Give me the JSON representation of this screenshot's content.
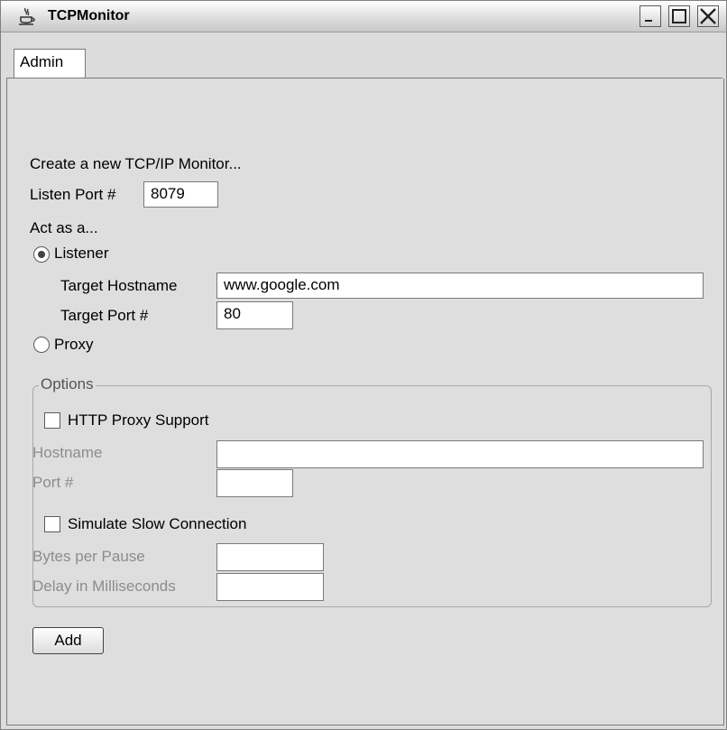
{
  "window": {
    "title": "TCPMonitor",
    "icon": "java-cup-icon",
    "controls": [
      "minimize-icon",
      "maximize-icon",
      "close-icon"
    ]
  },
  "tabs": [
    {
      "label": "Admin",
      "selected": true
    }
  ],
  "admin": {
    "heading": "Create a new TCP/IP Monitor...",
    "listen_port_label": "Listen Port #",
    "listen_port_value": "8079",
    "act_as_label": "Act as a...",
    "listener_label": "Listener",
    "listener_selected": true,
    "target_hostname_label": "Target Hostname",
    "target_hostname_value": "www.google.com",
    "target_port_label": "Target Port #",
    "target_port_value": "80",
    "proxy_label": "Proxy",
    "proxy_selected": false
  },
  "options": {
    "group_label": "Options",
    "http_proxy_label": "HTTP Proxy Support",
    "http_proxy_checked": false,
    "hostname_label": "Hostname",
    "hostname_value": "",
    "port_label": "Port #",
    "port_value": "",
    "slow_conn_label": "Simulate Slow Connection",
    "slow_conn_checked": false,
    "bytes_per_pause_label": "Bytes per Pause",
    "bytes_per_pause_value": "",
    "delay_label": "Delay in Milliseconds",
    "delay_value": ""
  },
  "add_button_label": "Add"
}
